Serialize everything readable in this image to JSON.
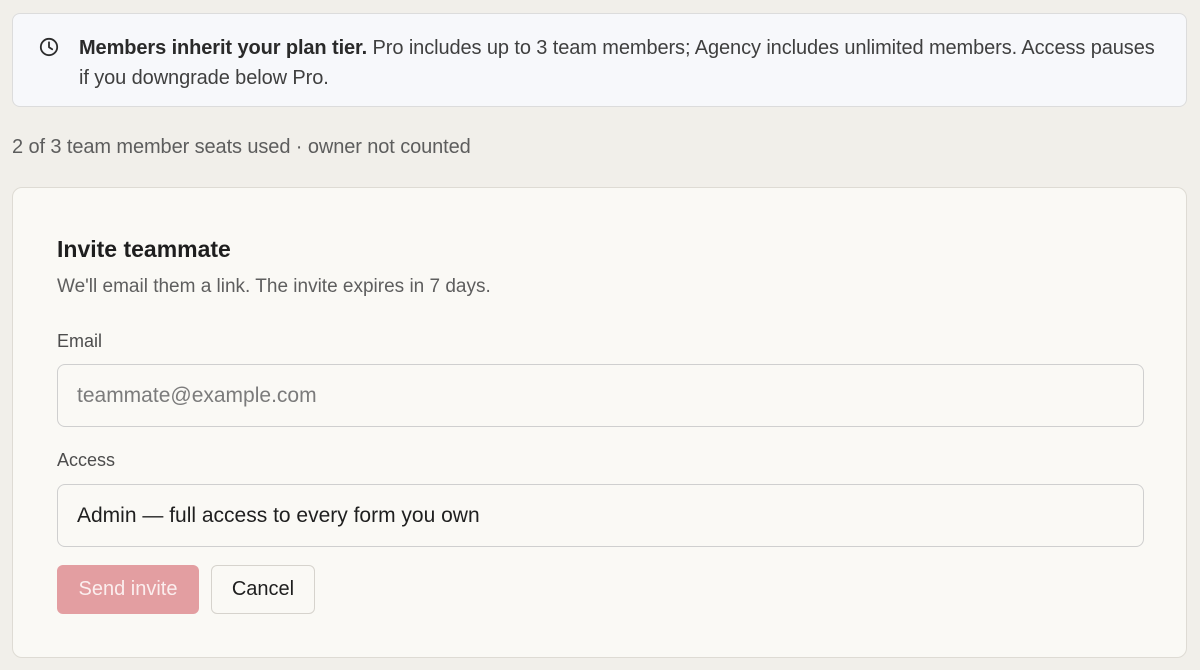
{
  "notice": {
    "icon": "clock-icon",
    "bold": "Members inherit your plan tier.",
    "text": " Pro includes up to 3 team members; Agency includes unlimited members. Access pauses if you downgrade below Pro."
  },
  "seats": {
    "text": "2 of 3 team member seats used · owner not counted"
  },
  "invite": {
    "title": "Invite teammate",
    "subtitle": "We'll email them a link. The invite expires in 7 days.",
    "email_label": "Email",
    "email_value": "",
    "email_placeholder": "teammate@example.com",
    "access_label": "Access",
    "access_value": "Admin — full access to every form you own",
    "send_label": "Send invite",
    "cancel_label": "Cancel"
  },
  "colors": {
    "page_bg": "#f1efea",
    "notice_bg": "#f7f8fb",
    "card_bg": "#faf9f5",
    "send_button_disabled": "#e39ea1"
  }
}
